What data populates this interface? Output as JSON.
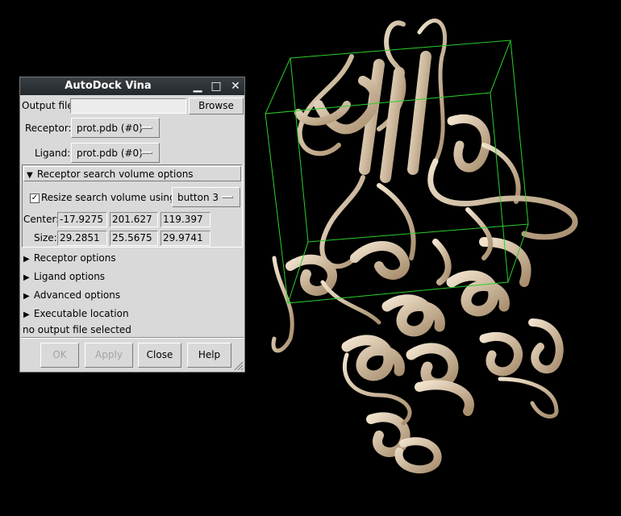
{
  "dialog": {
    "title": "AutoDock Vina",
    "output_file_label": "Output file:",
    "output_file_value": "",
    "browse_label": "Browse",
    "receptor_label": "Receptor:",
    "receptor_value": "prot.pdb (#0)",
    "ligand_label": "Ligand:",
    "ligand_value": "prot.pdb (#0)",
    "search_volume": {
      "header": "Receptor search volume options",
      "resize_label": "Resize search volume using",
      "resize_checked": true,
      "resize_button": "button 3",
      "center_label": "Center:",
      "center": [
        "-17.9275",
        "201.627",
        "119.397"
      ],
      "size_label": "Size:",
      "size": [
        "29.2851",
        "25.5675",
        "29.9741"
      ]
    },
    "sections": [
      "Receptor options",
      "Ligand options",
      "Advanced options",
      "Executable location"
    ],
    "status": "no output file selected",
    "buttons": {
      "ok": "OK",
      "apply": "Apply",
      "close": "Close",
      "help": "Help"
    }
  },
  "icons": [
    "minimize-icon",
    "maximize-icon",
    "close-icon",
    "expand-triangle-icon",
    "collapse-triangle-icon",
    "resize-grip-icon"
  ],
  "colors": {
    "viewport_bg": "#000000",
    "bounding_box": "#2bd12b",
    "ribbon": "#d9c4a6",
    "dialog_bg": "#d9d9d9",
    "titlebar": "#2c3034"
  }
}
